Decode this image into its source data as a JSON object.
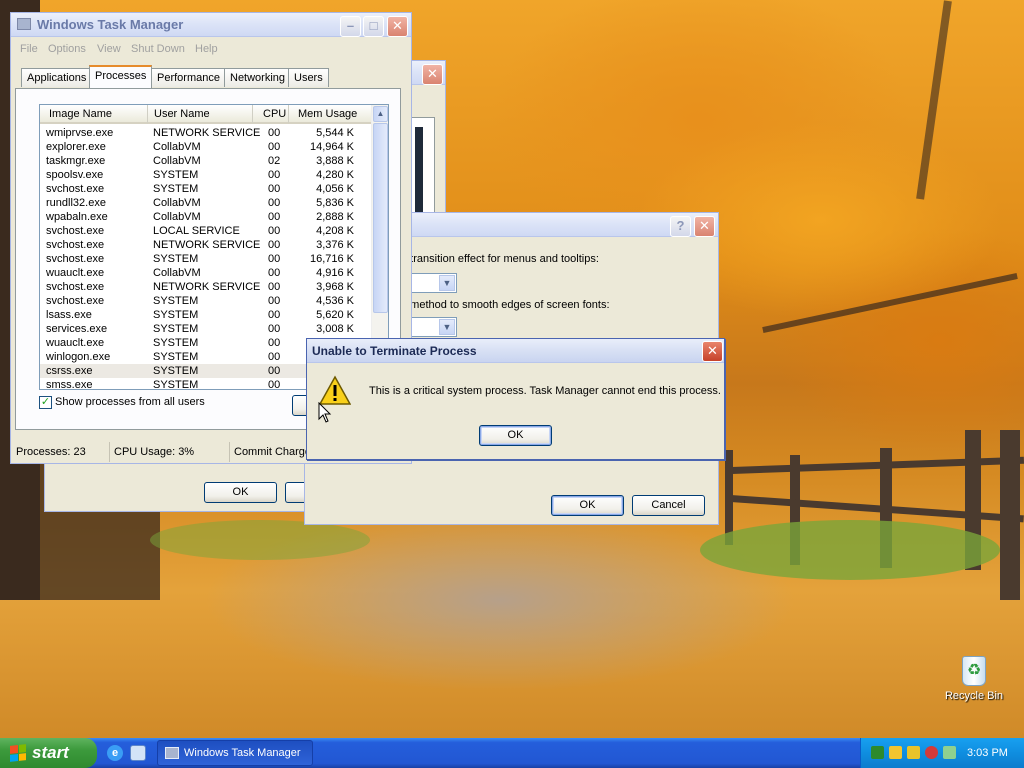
{
  "taskmanager": {
    "title": "Windows Task Manager",
    "menu": [
      "File",
      "Options",
      "View",
      "Shut Down",
      "Help"
    ],
    "tabs": [
      "Applications",
      "Processes",
      "Performance",
      "Networking",
      "Users"
    ],
    "columns": [
      "Image Name",
      "User Name",
      "CPU",
      "Mem Usage"
    ],
    "processes": [
      {
        "name": "wmiprvse.exe",
        "user": "NETWORK SERVICE",
        "cpu": "00",
        "mem": "5,544 K"
      },
      {
        "name": "explorer.exe",
        "user": "CollabVM",
        "cpu": "00",
        "mem": "14,964 K"
      },
      {
        "name": "taskmgr.exe",
        "user": "CollabVM",
        "cpu": "02",
        "mem": "3,888 K"
      },
      {
        "name": "spoolsv.exe",
        "user": "SYSTEM",
        "cpu": "00",
        "mem": "4,280 K"
      },
      {
        "name": "svchost.exe",
        "user": "SYSTEM",
        "cpu": "00",
        "mem": "4,056 K"
      },
      {
        "name": "rundll32.exe",
        "user": "CollabVM",
        "cpu": "00",
        "mem": "5,836 K"
      },
      {
        "name": "wpabaln.exe",
        "user": "CollabVM",
        "cpu": "00",
        "mem": "2,888 K"
      },
      {
        "name": "svchost.exe",
        "user": "LOCAL SERVICE",
        "cpu": "00",
        "mem": "4,208 K"
      },
      {
        "name": "svchost.exe",
        "user": "NETWORK SERVICE",
        "cpu": "00",
        "mem": "3,376 K"
      },
      {
        "name": "svchost.exe",
        "user": "SYSTEM",
        "cpu": "00",
        "mem": "16,716 K"
      },
      {
        "name": "wuauclt.exe",
        "user": "CollabVM",
        "cpu": "00",
        "mem": "4,916 K"
      },
      {
        "name": "svchost.exe",
        "user": "NETWORK SERVICE",
        "cpu": "00",
        "mem": "3,968 K"
      },
      {
        "name": "svchost.exe",
        "user": "SYSTEM",
        "cpu": "00",
        "mem": "4,536 K"
      },
      {
        "name": "lsass.exe",
        "user": "SYSTEM",
        "cpu": "00",
        "mem": "5,620 K"
      },
      {
        "name": "services.exe",
        "user": "SYSTEM",
        "cpu": "00",
        "mem": "3,008 K"
      },
      {
        "name": "wuauclt.exe",
        "user": "SYSTEM",
        "cpu": "00",
        "mem": ""
      },
      {
        "name": "winlogon.exe",
        "user": "SYSTEM",
        "cpu": "00",
        "mem": ""
      },
      {
        "name": "csrss.exe",
        "user": "SYSTEM",
        "cpu": "00",
        "mem": ""
      },
      {
        "name": "smss.exe",
        "user": "SYSTEM",
        "cpu": "00",
        "mem": ""
      }
    ],
    "show_all_label": "Show processes from all users",
    "show_all_checked": true,
    "status": {
      "processes": "Processes: 23",
      "cpu": "CPU Usage: 3%",
      "commit": "Commit Charge"
    }
  },
  "background_window": {
    "ok": "OK"
  },
  "effects_window": {
    "line1": "g transition effect for menus and tooltips:",
    "line2": "g method to smooth edges of screen fonts:",
    "ok": "OK",
    "cancel": "Cancel"
  },
  "dialog": {
    "title": "Unable to Terminate Process",
    "message": "This is a critical system process.  Task Manager cannot end this process.",
    "ok": "OK"
  },
  "desktop": {
    "recycle_bin": "Recycle Bin"
  },
  "taskbar": {
    "start": "start",
    "task_button": "Windows Task Manager",
    "clock": "3:03 PM"
  }
}
